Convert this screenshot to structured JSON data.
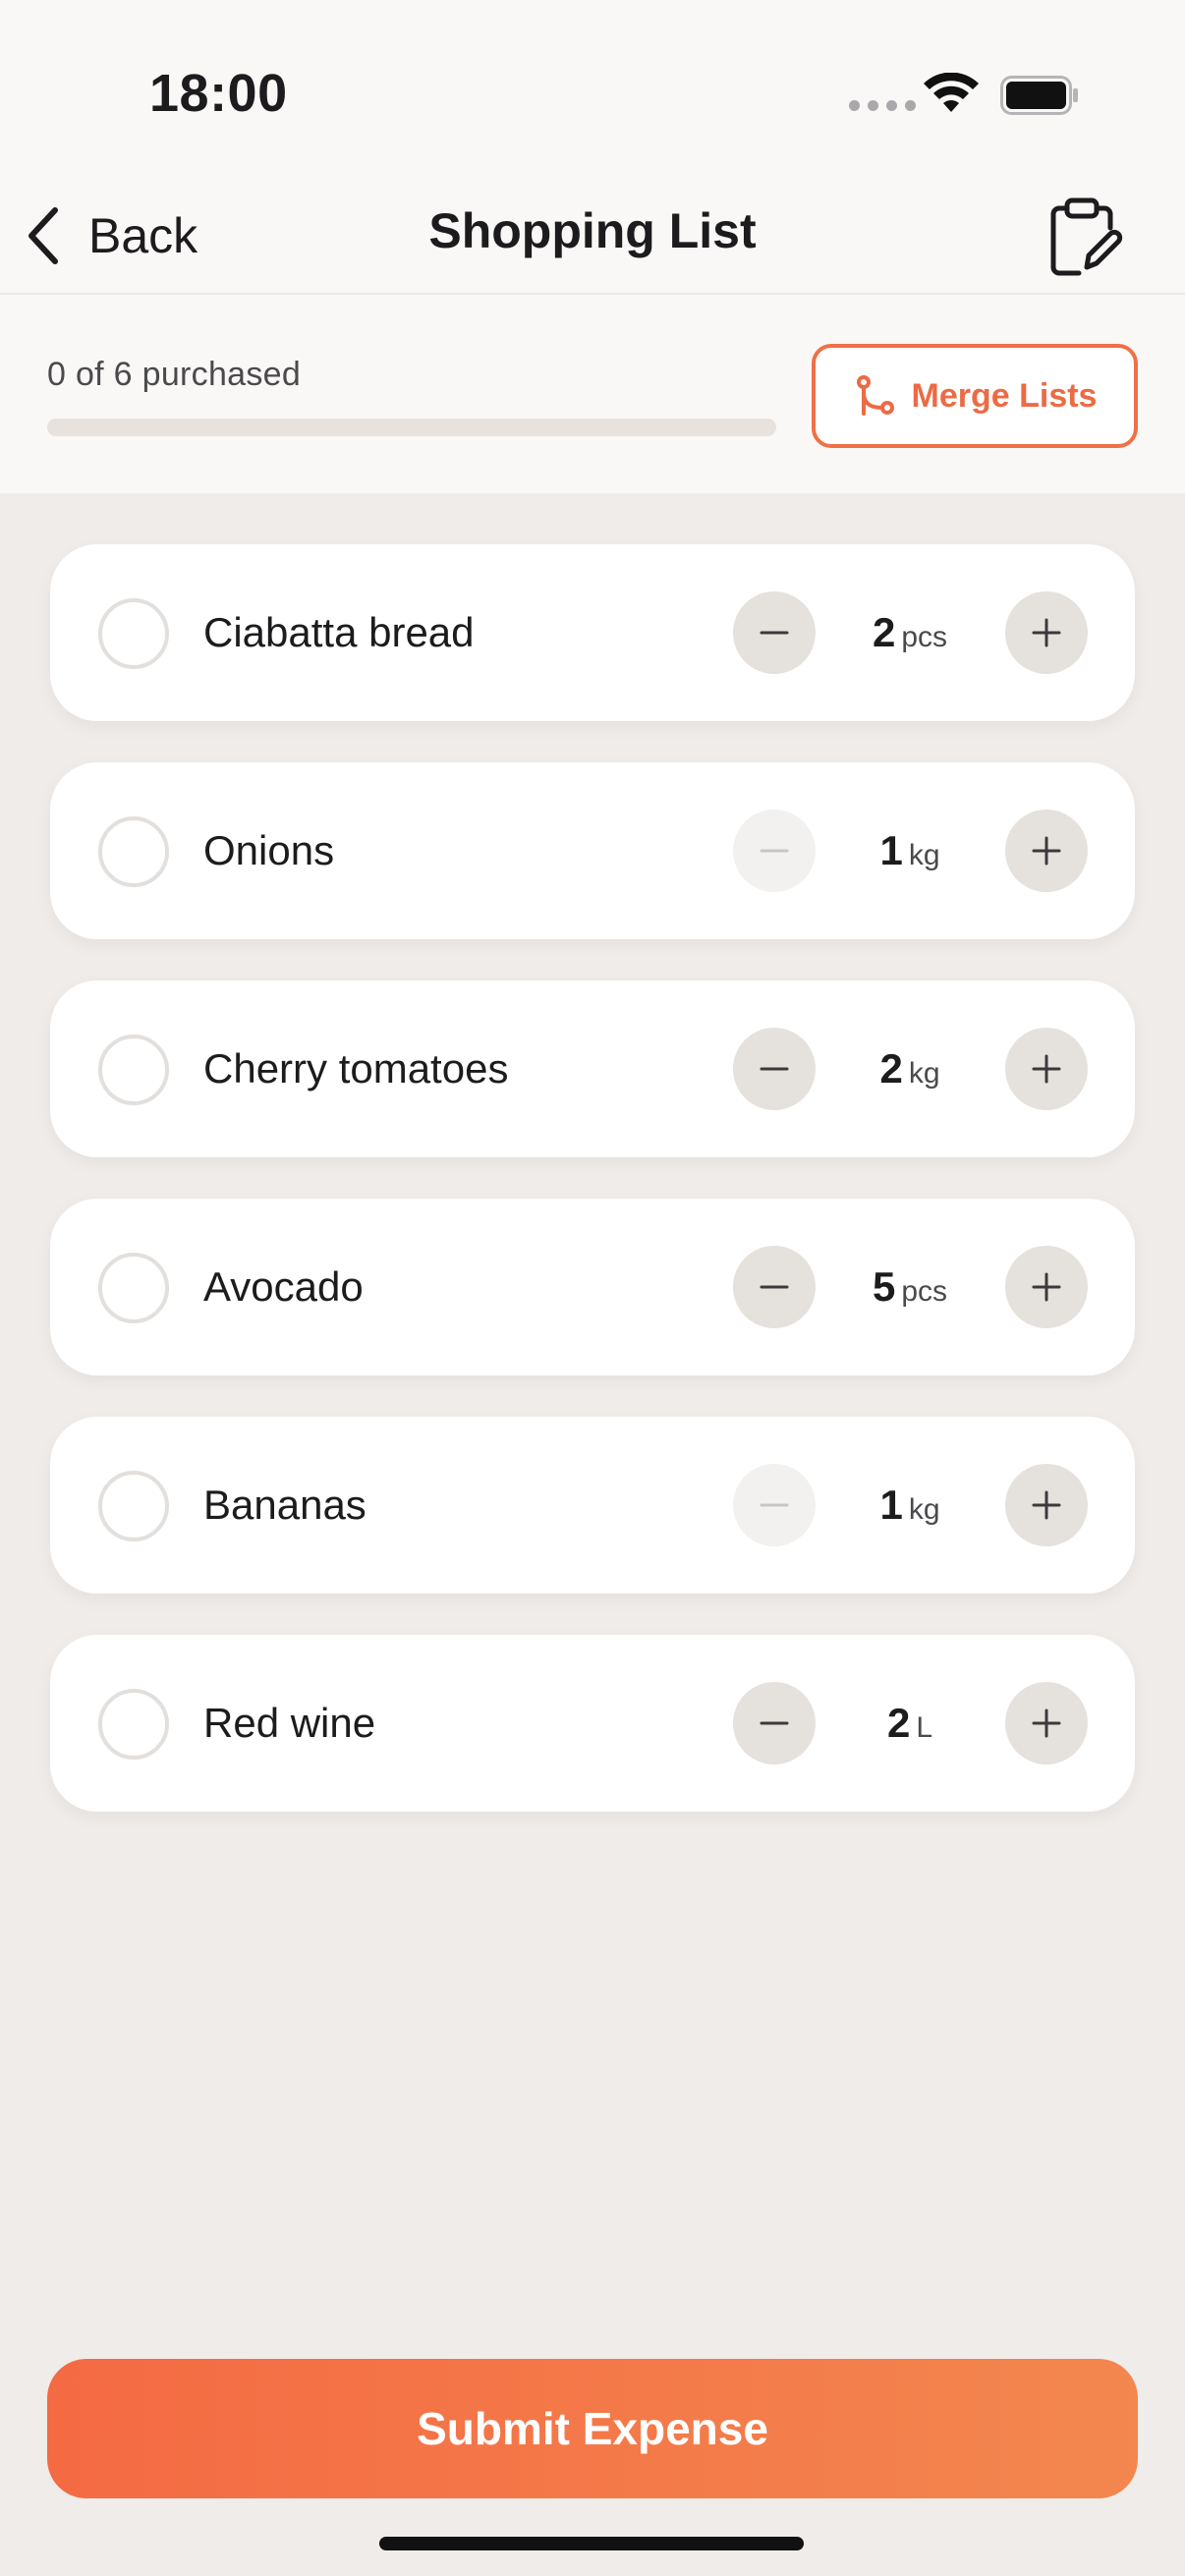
{
  "status_bar": {
    "time": "18:00"
  },
  "nav": {
    "back_label": "Back",
    "title": "Shopping List"
  },
  "progress": {
    "text": "0 of 6 purchased",
    "purchased": 0,
    "total": 6,
    "fraction": 0
  },
  "merge_button": {
    "label": "Merge Lists"
  },
  "items": [
    {
      "name": "Ciabatta bread",
      "qty": "2",
      "unit": "pcs",
      "checked": false,
      "minus_enabled": true
    },
    {
      "name": "Onions",
      "qty": "1",
      "unit": "kg",
      "checked": false,
      "minus_enabled": false
    },
    {
      "name": "Cherry tomatoes",
      "qty": "2",
      "unit": "kg",
      "checked": false,
      "minus_enabled": true
    },
    {
      "name": "Avocado",
      "qty": "5",
      "unit": "pcs",
      "checked": false,
      "minus_enabled": true
    },
    {
      "name": "Bananas",
      "qty": "1",
      "unit": "kg",
      "checked": false,
      "minus_enabled": false
    },
    {
      "name": "Red wine",
      "qty": "2",
      "unit": "L",
      "checked": false,
      "minus_enabled": true
    }
  ],
  "submit_button": {
    "label": "Submit Expense"
  },
  "colors": {
    "accent": "#f07047",
    "background": "#f0ece9",
    "card": "#ffffff"
  },
  "icons": {
    "back": "chevron-left-icon",
    "clipboard": "clipboard-edit-icon",
    "merge": "merge-branch-icon",
    "minus": "minus-icon",
    "plus": "plus-icon"
  }
}
